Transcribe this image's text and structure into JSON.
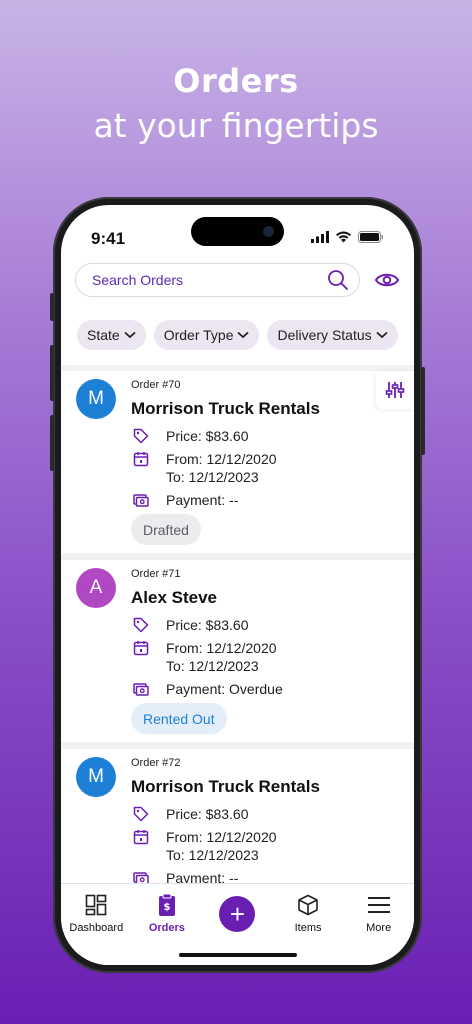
{
  "hero": {
    "title": "Orders",
    "subtitle": "at your fingertips"
  },
  "status_bar": {
    "time": "9:41"
  },
  "search": {
    "placeholder": "Search Orders"
  },
  "filters": [
    {
      "label": "State"
    },
    {
      "label": "Order Type"
    },
    {
      "label": "Delivery Status"
    }
  ],
  "orders": [
    {
      "order_no": "Order #70",
      "avatar_letter": "M",
      "avatar_color": "#1e7fd6",
      "customer": "Morrison Truck Rentals",
      "price": "Price: $83.60",
      "from": "From: 12/12/2020",
      "to": "To: 12/12/2023",
      "payment": "Payment: --",
      "status": "Drafted",
      "status_bg": "#ececee",
      "status_color": "#5c5c66"
    },
    {
      "order_no": "Order #71",
      "avatar_letter": "A",
      "avatar_color": "#b048c4",
      "customer": "Alex Steve",
      "price": "Price: $83.60",
      "from": "From: 12/12/2020",
      "to": "To: 12/12/2023",
      "payment": "Payment: Overdue",
      "status": "Rented Out",
      "status_bg": "#e3eef9",
      "status_color": "#1e7fd6"
    },
    {
      "order_no": "Order #72",
      "avatar_letter": "M",
      "avatar_color": "#1e7fd6",
      "customer": "Morrison Truck Rentals",
      "price": "Price: $83.60",
      "from": "From: 12/12/2020",
      "to": "To: 12/12/2023",
      "payment": "Payment: --"
    }
  ],
  "tabs": [
    {
      "label": "Dashboard",
      "icon": "dashboard-icon"
    },
    {
      "label": "Orders",
      "icon": "orders-icon",
      "active": true
    },
    {
      "label": "",
      "icon": "plus-icon"
    },
    {
      "label": "Items",
      "icon": "box-icon"
    },
    {
      "label": "More",
      "icon": "menu-icon"
    }
  ],
  "colors": {
    "accent": "#6a1fb3",
    "brand_purple": "#5b2bb0"
  }
}
